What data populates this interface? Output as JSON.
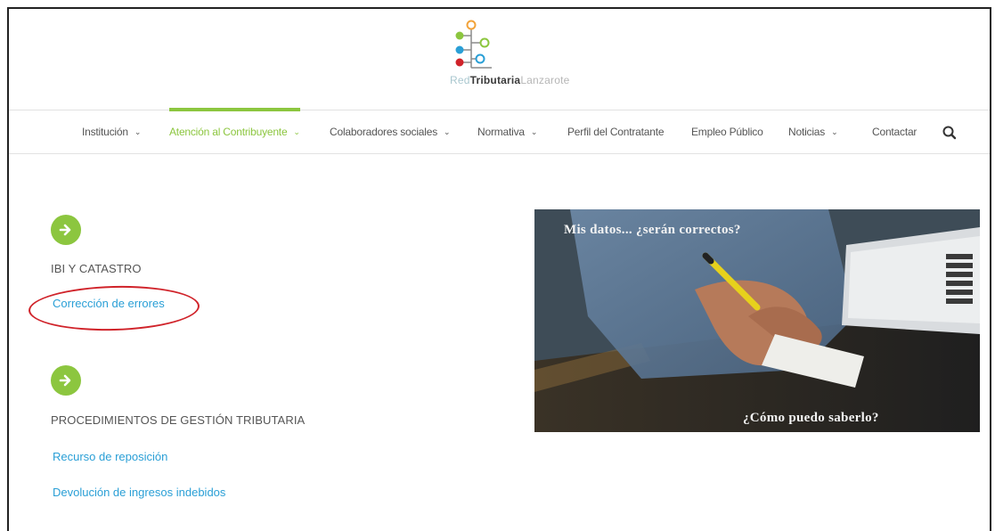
{
  "brand": {
    "logo_part1": "Red",
    "logo_part2": "Tributaria",
    "logo_part3": "Lanzarote"
  },
  "nav": {
    "items": [
      {
        "label": "Institución",
        "dropdown": true
      },
      {
        "label": "Atención al Contribuyente",
        "dropdown": true,
        "active": true
      },
      {
        "label": "Colaboradores sociales",
        "dropdown": true
      },
      {
        "label": "Normativa",
        "dropdown": true
      },
      {
        "label": "Perfil del Contratante",
        "dropdown": false
      },
      {
        "label": "Empleo Público",
        "dropdown": false
      },
      {
        "label": "Noticias",
        "dropdown": true
      },
      {
        "label": "Contactar",
        "dropdown": false
      }
    ],
    "search_icon": "search-icon"
  },
  "sections": [
    {
      "title": "IBI Y CATASTRO",
      "links": [
        "Corrección de errores"
      ]
    },
    {
      "title": "PROCEDIMIENTOS DE GESTIÓN TRIBUTARIA",
      "links": [
        "Recurso de reposición",
        "Devolución de ingresos indebidos"
      ]
    }
  ],
  "hero": {
    "headline": "Mis datos... ¿serán correctos?",
    "subline": "¿Cómo puedo saberlo?"
  },
  "colors": {
    "accent": "#8cc63f",
    "link": "#2a9fd6",
    "highlight": "#d0232a"
  }
}
